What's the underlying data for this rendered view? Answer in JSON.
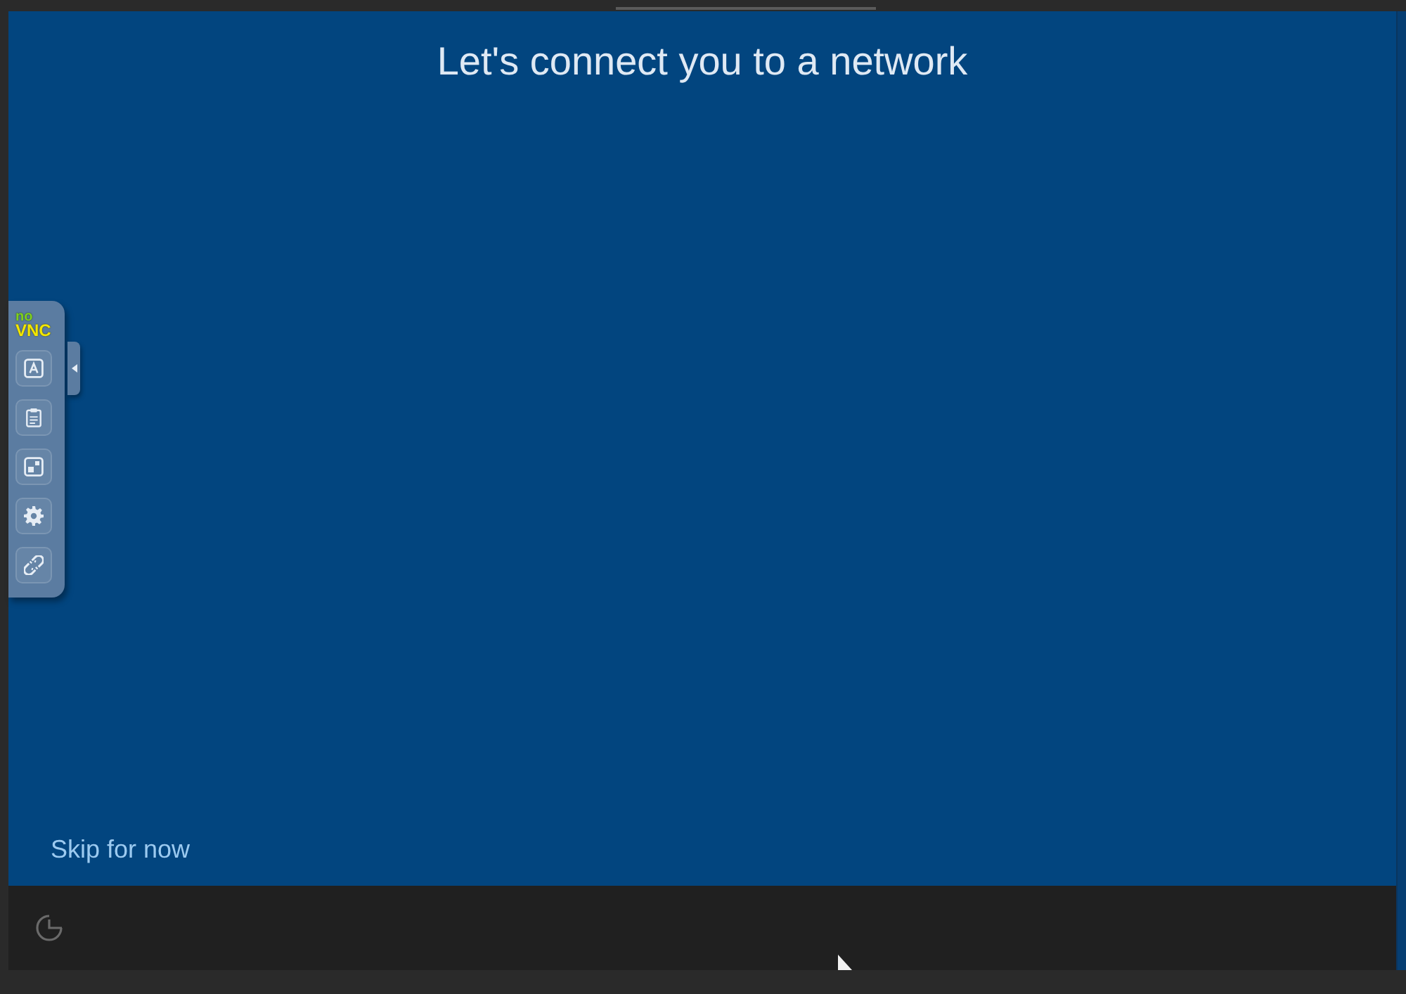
{
  "window": {
    "title": "Let's connect you to a network"
  },
  "skip_link": "Skip for now",
  "vnc_control_bar": {
    "logo": [
      "no",
      "VNC"
    ]
  }
}
